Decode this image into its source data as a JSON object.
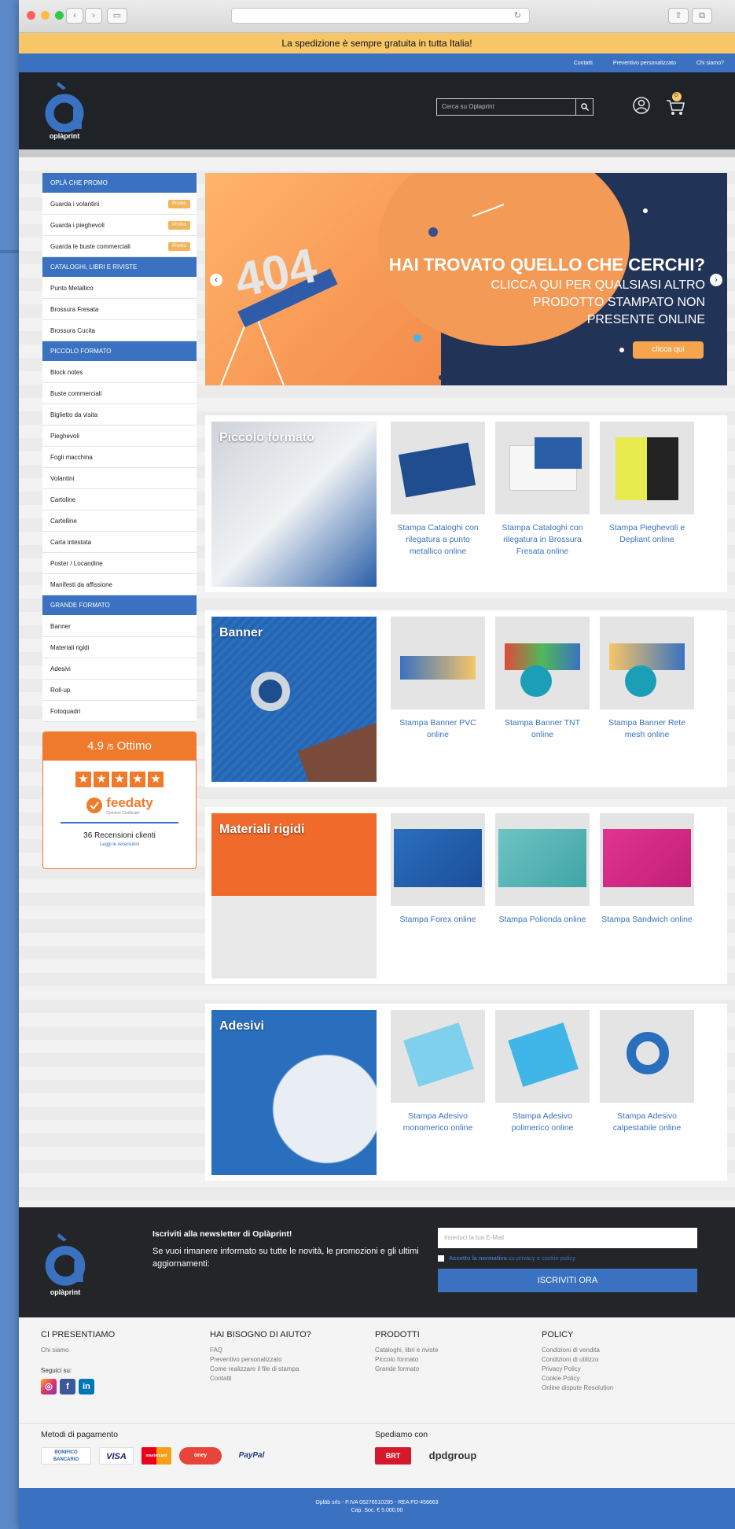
{
  "browser": {
    "back_icon": "‹",
    "forward_icon": "›",
    "reload_icon": "↻",
    "share_icon": "⇧",
    "tabs_icon": "⧉",
    "sidebar_icon": "▭"
  },
  "banner": {
    "shipping_text": "La spedizione è sempre gratuita in tutta Italia!"
  },
  "toplinks": [
    "Contatti",
    "Preventivo personalizzato",
    "Chi siamo?"
  ],
  "header": {
    "logo_text": "oplàprint",
    "search_placeholder": "Cerca su Oplaprint",
    "cart_count": "0"
  },
  "sidebar": {
    "groups": [
      {
        "title": "OPLÀ CHE PROMO",
        "items": [
          {
            "label": "Guarda i volantini",
            "badge": "Promo"
          },
          {
            "label": "Guarda i pieghevoli",
            "badge": "Promo"
          },
          {
            "label": "Guarda le buste commerciali",
            "badge": "Promo"
          }
        ]
      },
      {
        "title": "CATALOGHI, LIBRI E RIVISTE",
        "items": [
          {
            "label": "Punto Metallico"
          },
          {
            "label": "Brossura Fresata"
          },
          {
            "label": "Brossura Cucita"
          }
        ]
      },
      {
        "title": "PICCOLO FORMATO",
        "items": [
          {
            "label": "Block notes"
          },
          {
            "label": "Buste commerciali"
          },
          {
            "label": "Biglietto da visita"
          },
          {
            "label": "Pieghevoli"
          },
          {
            "label": "Fogli macchina"
          },
          {
            "label": "Volantini"
          },
          {
            "label": "Cartoline"
          },
          {
            "label": "Cartelline"
          },
          {
            "label": "Carta intestata"
          },
          {
            "label": "Poster / Locandine"
          },
          {
            "label": "Manifesti da affissione"
          }
        ]
      },
      {
        "title": "GRANDE FORMATO",
        "items": [
          {
            "label": "Banner"
          },
          {
            "label": "Materiali rigidi"
          },
          {
            "label": "Adesivi"
          },
          {
            "label": "Roll-up"
          },
          {
            "label": "Fotoquadri"
          }
        ]
      }
    ]
  },
  "review": {
    "score": "4.9",
    "scale": "/5",
    "rating": "Ottimo",
    "brand": "feedaty",
    "brand_sub": "Opinioni Certificate",
    "count": "36 Recensioni clienti",
    "link": "Leggi le recensioni",
    "stars": 5
  },
  "hero": {
    "big_text": "404",
    "title": "HAI TROVATO QUELLO CHE CERCHI?",
    "subtitle": "CLICCA QUI PER QUALSIASI ALTRO PRODOTTO STAMPATO NON PRESENTE ONLINE",
    "button": "clicca qui"
  },
  "sections": [
    {
      "title": "Piccolo formato",
      "products": [
        "Stampa Cataloghi con rilegatura a punto metallico online",
        "Stampa Cataloghi con rilegatura in Brossura Fresata online",
        "Stampa Pieghevoli e Depliant online"
      ]
    },
    {
      "title": "Banner",
      "products": [
        "Stampa Banner PVC online",
        "Stampa Banner TNT online",
        "Stampa Banner Rete mesh online"
      ]
    },
    {
      "title": "Materiali rigidi",
      "products": [
        "Stampa Forex online",
        "Stampa Polionda online",
        "Stampa Sandwich online"
      ]
    },
    {
      "title": "Adesivi",
      "products": [
        "Stampa Adesivo monomerico online",
        "Stampa Adesivo polimerico online",
        "Stampa Adesivo calpestabile online"
      ]
    }
  ],
  "newsletter": {
    "title": "Iscriviti alla newsletter di Oplàprint!",
    "desc": "Se vuoi rimanere informato su tutte le novità, le promozioni e gli ultimi aggiornamenti:",
    "placeholder": "Inserisci la tua E-Mail",
    "consent_a": "Accetto la normativa",
    "consent_b": "su privacy e cookie policy",
    "button": "ISCRIVITI ORA"
  },
  "footer": {
    "col1": {
      "title": "CI PRESENTIAMO",
      "items": [
        "Chi siamo"
      ],
      "social_label": "Seguici su:"
    },
    "col2": {
      "title": "HAI BISOGNO DI AIUTO?",
      "items": [
        "FAQ",
        "Preventivo personalizzato",
        "Come realizzare il file di stampa",
        "Contatti"
      ]
    },
    "col3": {
      "title": "PRODOTTI",
      "items": [
        "Cataloghi, libri e riviste",
        "Piccolo formato",
        "Grande formato"
      ]
    },
    "col4": {
      "title": "POLICY",
      "items": [
        "Condizioni di vendita",
        "Condizioni di utilizzo",
        "Privacy Policy",
        "Cookie Policy",
        "Online dispute Resolution"
      ]
    }
  },
  "payments": {
    "title": "Metodi di pagamento",
    "methods": [
      "BONIFICO BANCARIO",
      "VISA",
      "mastercard",
      "oney",
      "PayPal"
    ]
  },
  "shipping": {
    "title": "Spediamo con",
    "carriers": [
      "BRT",
      "dpdgroup"
    ]
  },
  "legal": {
    "line1": "Opläb srls - P.IVA 05276510285 - REA PD-456663",
    "line2": "Cap. Soc. € 5.000,00"
  },
  "colors": {
    "primary": "#3a72c1",
    "accent": "#f07a2b",
    "dark": "#1f2227",
    "ship_bar": "#f6c667"
  }
}
